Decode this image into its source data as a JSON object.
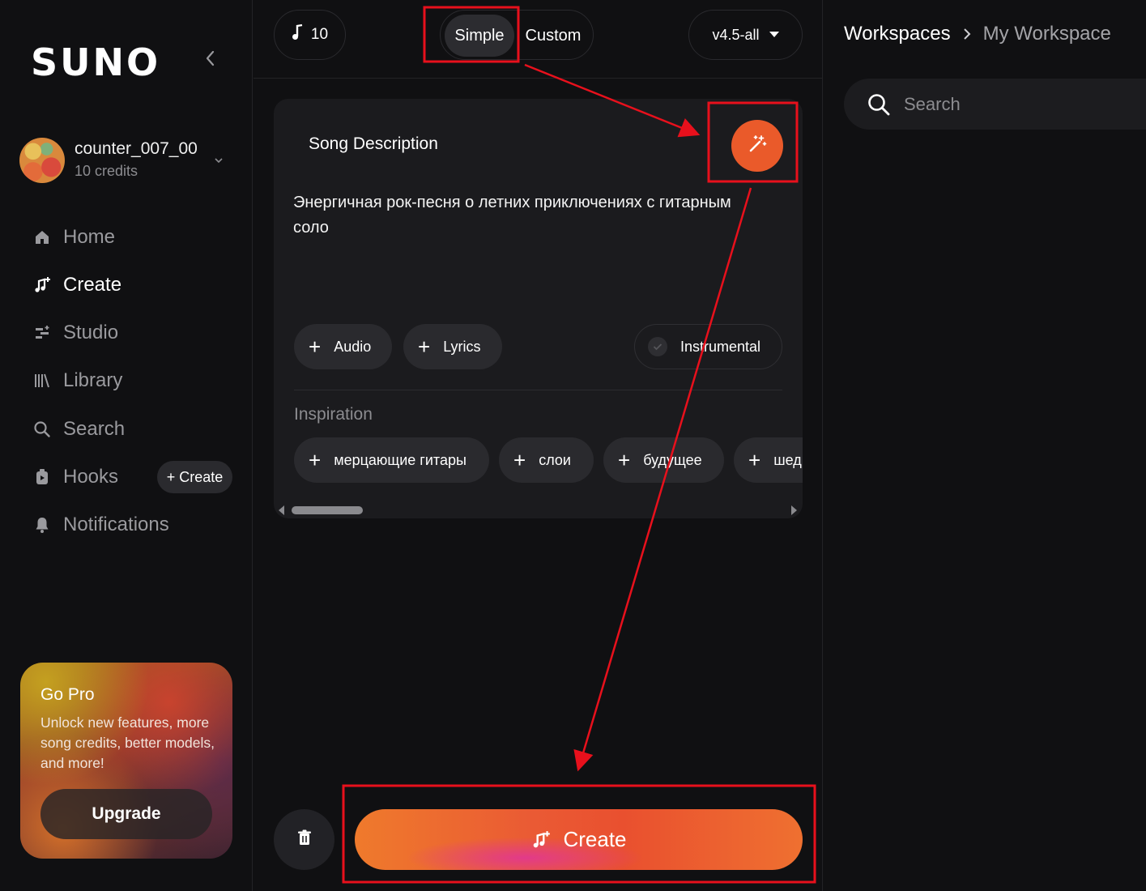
{
  "brand": {
    "logo": "SUNO"
  },
  "user": {
    "name": "counter_007_00",
    "credits": "10 credits"
  },
  "nav": [
    {
      "label": "Home",
      "icon": "home-icon"
    },
    {
      "label": "Create",
      "icon": "create-music-icon"
    },
    {
      "label": "Studio",
      "icon": "studio-icon"
    },
    {
      "label": "Library",
      "icon": "library-icon"
    },
    {
      "label": "Search",
      "icon": "search-icon"
    },
    {
      "label": "Hooks",
      "icon": "hooks-icon"
    },
    {
      "label": "Notifications",
      "icon": "bell-icon"
    }
  ],
  "hooks_create_label": "+ Create",
  "gopro": {
    "title": "Go Pro",
    "text": "Unlock new features, more song credits, better models, and more!",
    "button": "Upgrade"
  },
  "topbar": {
    "credits": "10",
    "mode_simple": "Simple",
    "mode_custom": "Custom",
    "version": "v4.5-all"
  },
  "card": {
    "label": "Song Description",
    "description": "Энергичная рок-песня о летних приключениях с гитарным соло",
    "audio_label": "Audio",
    "lyrics_label": "Lyrics",
    "instrumental_label": "Instrumental",
    "inspiration_label": "Inspiration",
    "inspiration": [
      "мерцающие гитары",
      "слои",
      "будущее",
      "шед"
    ]
  },
  "create_button": "Create",
  "right": {
    "crumb_root": "Workspaces",
    "crumb_current": "My Workspace",
    "search_placeholder": "Search"
  },
  "colors": {
    "accent": "#ea5a2a",
    "annotation": "#e8101c",
    "background": "#101012"
  }
}
